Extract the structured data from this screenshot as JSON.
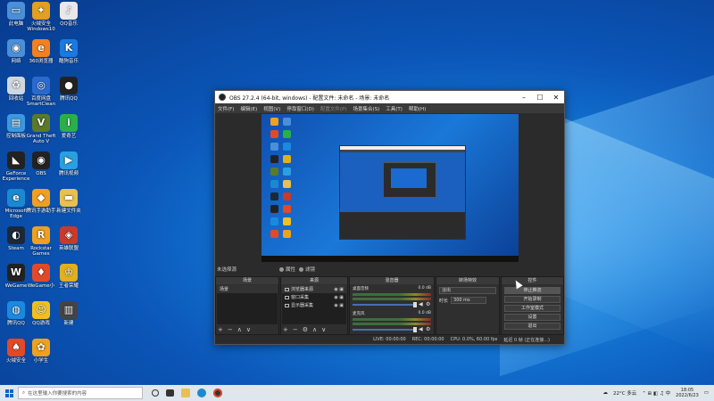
{
  "desktop": {
    "icons": [
      {
        "label": "此电脑",
        "color": "#4a8fd8",
        "glyph": "▭"
      },
      {
        "label": "火绒安全\nWindows10",
        "color": "#e0a020",
        "glyph": "✦"
      },
      {
        "label": "QQ音乐",
        "color": "#e8e8e8",
        "glyph": "♪"
      },
      {
        "label": "网络",
        "color": "#4a8fd8",
        "glyph": "◉"
      },
      {
        "label": "360浏览器",
        "color": "#f08020",
        "glyph": "e"
      },
      {
        "label": "酷狗音乐",
        "color": "#1a7ae0",
        "glyph": "K"
      },
      {
        "label": "回收站",
        "color": "#cfd8e0",
        "glyph": "♻"
      },
      {
        "label": "百度网盘\nSmartClean",
        "color": "#2a6ad0",
        "glyph": "◎"
      },
      {
        "label": "腾讯QQ",
        "color": "#222",
        "glyph": "●"
      },
      {
        "label": "控制面板",
        "color": "#3a9ae0",
        "glyph": "▤"
      },
      {
        "label": "Grand Theft\nAuto V",
        "color": "#5a7a2a",
        "glyph": "V"
      },
      {
        "label": "爱奇艺",
        "color": "#2ab04a",
        "glyph": "i"
      },
      {
        "label": "GeForce\nExperience",
        "color": "#222",
        "glyph": "◣"
      },
      {
        "label": "OBS",
        "color": "#222",
        "glyph": "◉"
      },
      {
        "label": "腾讯视频",
        "color": "#2aa0e0",
        "glyph": "▶"
      },
      {
        "label": "Microsoft\nEdge",
        "color": "#1a8ad0",
        "glyph": "e"
      },
      {
        "label": "腾讯手游助手",
        "color": "#f0a020",
        "glyph": "◆"
      },
      {
        "label": "新建文件夹",
        "color": "#e8c050",
        "glyph": "▬"
      },
      {
        "label": "Steam",
        "color": "#1b2838",
        "glyph": "◐"
      },
      {
        "label": "Rockstar\nGames",
        "color": "#f0a020",
        "glyph": "R"
      },
      {
        "label": "英雄联盟",
        "color": "#c83a2a",
        "glyph": "◈"
      },
      {
        "label": "WeGame",
        "color": "#222",
        "glyph": "W"
      },
      {
        "label": "WeGame小",
        "color": "#e04a2a",
        "glyph": "♦"
      },
      {
        "label": "王者荣耀",
        "color": "#e0b020",
        "glyph": "♔"
      },
      {
        "label": "腾讯QQ",
        "color": "#1a8ae0",
        "glyph": "◍"
      },
      {
        "label": "QQ游戏",
        "color": "#f0c020",
        "glyph": "☺"
      },
      {
        "label": "新建",
        "color": "#444",
        "glyph": "▥"
      },
      {
        "label": "火绒安全",
        "color": "#e04a2a",
        "glyph": "♠"
      },
      {
        "label": "小学生",
        "color": "#f0a020",
        "glyph": "✿"
      }
    ]
  },
  "obs": {
    "title": "OBS 27.2.4 (64-bit, windows) - 配置文件: 未命名 - 场景: 未命名",
    "menu": [
      "文件(F)",
      "编辑(E)",
      "视图(V)",
      "停靠窗口(D)",
      "配置文件(P)",
      "场景集合(S)",
      "工具(T)",
      "帮助(H)"
    ],
    "menu_dim_index": 4,
    "no_source": "未选择源",
    "properties_btn": "属性",
    "filters_btn": "滤镜",
    "docks": {
      "scenes": {
        "title": "场景",
        "items": [
          "场景"
        ]
      },
      "sources": {
        "title": "来源",
        "items": [
          "浏览器来源",
          "窗口采集",
          "显示器采集"
        ]
      },
      "mixer": {
        "title": "混音器",
        "channels": [
          {
            "name": "桌面音频",
            "db": "0.0 dB"
          },
          {
            "name": "麦克风",
            "db": "0.0 dB"
          }
        ]
      },
      "transitions": {
        "title": "转场特效",
        "type": "淡出",
        "duration_label": "时长",
        "duration": "300 ms"
      },
      "controls": {
        "title": "控件",
        "buttons": [
          "停止推流",
          "开始录制",
          "工作室模式",
          "设置",
          "退出"
        ]
      }
    },
    "status": {
      "live": "LIVE: 00:00:00",
      "rec": "REC: 00:00:00",
      "cpu": "CPU: 0.0%, 60.00 fps",
      "connecting": "延迟 0 帧 (正在连接...)"
    }
  },
  "taskbar": {
    "search_placeholder": "在这里输入你要搜索的内容",
    "weather": "22°C 多云",
    "time": "18:05",
    "date": "2022/6/23"
  }
}
